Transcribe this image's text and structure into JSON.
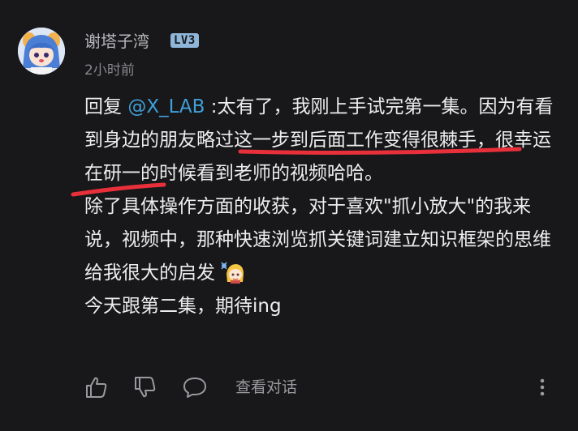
{
  "comment": {
    "username": "谢塔子湾",
    "level_badge": "LV3",
    "timestamp": "2小时前",
    "reply_prefix": "回复 ",
    "mention": "@X_LAB",
    "paragraph1_rest": " :太有了，我刚上手试完第一集。因为有看到身边的朋友略过这一步到后面工作变得很棘手，很幸运在研一的时候看到老师的视频哈哈。",
    "paragraph2": "除了具体操作方面的收获，对于喜欢\"抓小放大\"的我来说，视频中，那种快速浏览抓关键词建立知识框架的思维给我很大的启发",
    "paragraph3": "今天跟第二集，期待ing",
    "sticker_icon": "anime-girl-sticker-icon"
  },
  "actions": {
    "like_icon": "thumbs-up-icon",
    "dislike_icon": "thumbs-down-icon",
    "reply_icon": "speech-bubble-icon",
    "view_conversation_label": "查看对话",
    "more_icon": "vertical-dots-icon"
  },
  "colors": {
    "background": "#18181a",
    "text": "#ededee",
    "muted": "#87878b",
    "mention": "#3f9fd8",
    "underline_annotation": "#e8303a",
    "badge": "#8fb6d8"
  }
}
